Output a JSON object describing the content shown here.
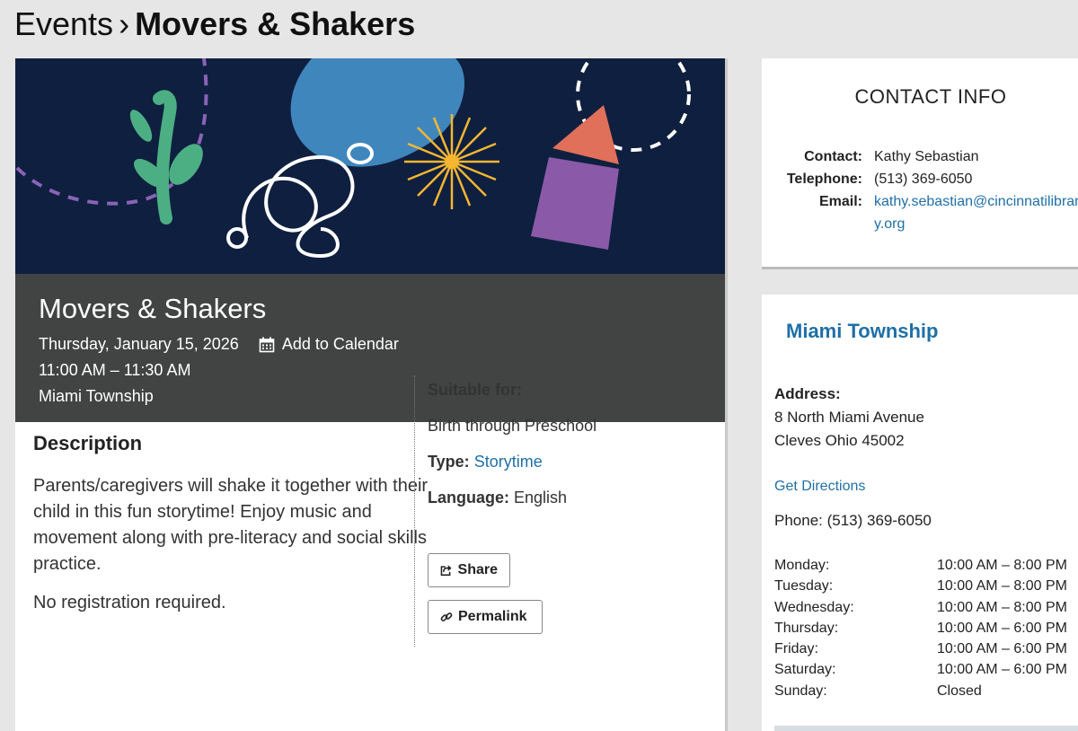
{
  "breadcrumb": {
    "parent": "Events",
    "separator": "›",
    "current": "Movers & Shakers"
  },
  "event": {
    "title": "Movers & Shakers",
    "date": "Thursday, January 15, 2026",
    "add_to_calendar": "Add to Calendar",
    "time": "11:00 AM – 11:30 AM",
    "location": "Miami Township"
  },
  "description": {
    "heading": "Description",
    "paragraphs": [
      "Parents/caregivers will shake it together with their child in this fun storytime!  Enjoy music and movement along with pre-literacy and social skills practice.",
      "No registration required."
    ]
  },
  "details": {
    "suitable_label": "Suitable for:",
    "suitable_value": "Birth through Preschool",
    "type_label": "Type:",
    "type_value": "Storytime",
    "language_label": "Language:",
    "language_value": "English",
    "share_label": "Share",
    "permalink_label": "Permalink"
  },
  "contact": {
    "heading": "CONTACT INFO",
    "contact_label": "Contact:",
    "contact_value": "Kathy Sebastian",
    "telephone_label": "Telephone:",
    "telephone_value": "(513) 369-6050",
    "email_label": "Email:",
    "email_value": "kathy.sebastian@cincinnatilibrary.org"
  },
  "branch": {
    "name": "Miami Township",
    "address_label": "Address:",
    "address_line1": "8 North Miami Avenue",
    "address_line2": "Cleves Ohio 45002",
    "directions": "Get Directions",
    "phone": "Phone: (513) 369-6050",
    "hours": [
      {
        "day": "Monday:",
        "time": "10:00 AM – 8:00 PM"
      },
      {
        "day": "Tuesday:",
        "time": "10:00 AM – 8:00 PM"
      },
      {
        "day": "Wednesday:",
        "time": "10:00 AM – 8:00 PM"
      },
      {
        "day": "Thursday:",
        "time": "10:00 AM – 6:00 PM"
      },
      {
        "day": "Friday:",
        "time": "10:00 AM – 6:00 PM"
      },
      {
        "day": "Saturday:",
        "time": "10:00 AM – 6:00 PM"
      },
      {
        "day": "Sunday:",
        "time": "Closed"
      }
    ]
  },
  "colors": {
    "link": "#1f6fa8",
    "hero_bg": "#0f1f3f",
    "banner_bg": "#424343",
    "page_bg": "#e6e6e6"
  }
}
